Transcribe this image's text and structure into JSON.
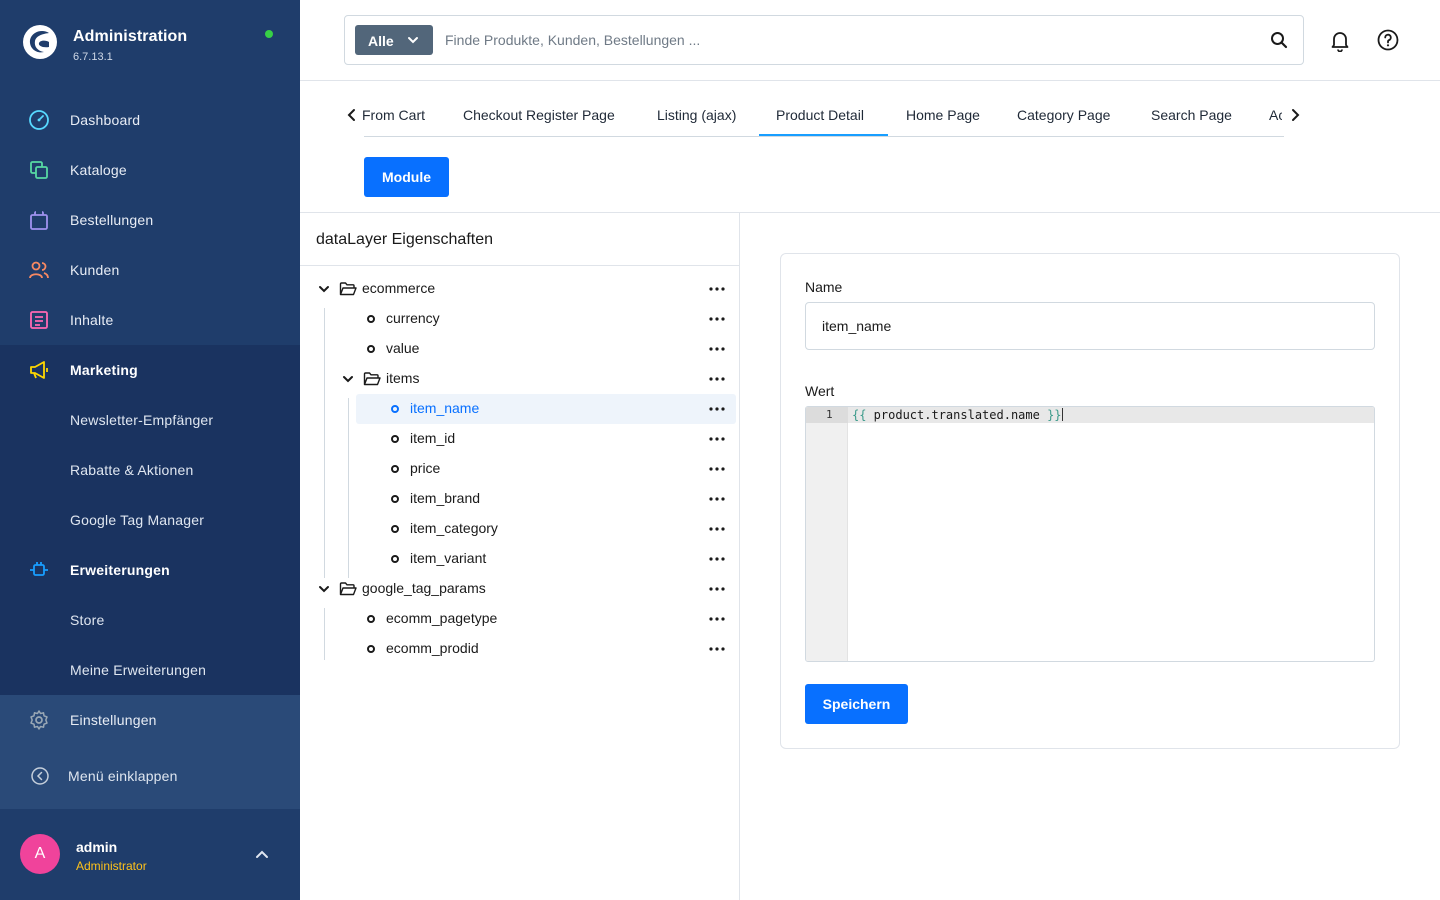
{
  "app": {
    "title": "Administration",
    "version": "6.7.13.1",
    "status_color": "#37d046",
    "logo": "shopware-logo-icon"
  },
  "sidebar": {
    "items": [
      {
        "label": "Dashboard",
        "icon": "dashboard-gauge-icon",
        "color": "#57d9ff"
      },
      {
        "label": "Kataloge",
        "icon": "catalog-icon",
        "color": "#57d9a3"
      },
      {
        "label": "Bestellungen",
        "icon": "shopping-bag-icon",
        "color": "#a092f0"
      },
      {
        "label": "Kunden",
        "icon": "customers-icon",
        "color": "#f88962"
      },
      {
        "label": "Inhalte",
        "icon": "content-icon",
        "color": "#ff68b4"
      },
      {
        "label": "Marketing",
        "icon": "megaphone-icon",
        "color": "#ffd700"
      },
      {
        "label": "Newsletter-Empfänger"
      },
      {
        "label": "Rabatte & Aktionen"
      },
      {
        "label": "Google Tag Manager"
      },
      {
        "label": "Erweiterungen",
        "icon": "plug-icon",
        "color": "#189eff"
      },
      {
        "label": "Store"
      },
      {
        "label": "Meine Erweiterungen"
      },
      {
        "label": "Einstellungen",
        "icon": "gear-icon",
        "color": "#9aa8b5"
      }
    ],
    "collapse_label": "Menü einklappen"
  },
  "user": {
    "initial": "A",
    "name": "admin",
    "role": "Administrator",
    "avatar_color": "#f0439b",
    "role_color": "#ffc21a"
  },
  "search": {
    "type_label": "Alle",
    "placeholder": "Finde Produkte, Kunden, Bestellungen ..."
  },
  "tabs": {
    "items": [
      "From Cart",
      "Checkout Register Page",
      "Listing (ajax)",
      "Product Detail",
      "Home Page",
      "Category Page",
      "Search Page",
      "Ac"
    ],
    "active": "Product Detail",
    "module_label": "Module"
  },
  "tree": {
    "title": "dataLayer Eigenschaften",
    "nodes": [
      {
        "label": "ecommerce",
        "type": "folder",
        "expanded": true
      },
      {
        "label": "currency",
        "type": "leaf"
      },
      {
        "label": "value",
        "type": "leaf"
      },
      {
        "label": "items",
        "type": "folder",
        "expanded": true
      },
      {
        "label": "item_name",
        "type": "leaf",
        "selected": true
      },
      {
        "label": "item_id",
        "type": "leaf"
      },
      {
        "label": "price",
        "type": "leaf"
      },
      {
        "label": "item_brand",
        "type": "leaf"
      },
      {
        "label": "item_category",
        "type": "leaf"
      },
      {
        "label": "item_variant",
        "type": "leaf"
      },
      {
        "label": "google_tag_params",
        "type": "folder",
        "expanded": true
      },
      {
        "label": "ecomm_pagetype",
        "type": "leaf"
      },
      {
        "label": "ecomm_prodid",
        "type": "leaf"
      }
    ]
  },
  "form": {
    "name_label": "Name",
    "name_value": "item_name",
    "value_label": "Wert",
    "code": {
      "line_number": "1",
      "open_brace": "{{",
      "content": " product.translated.name ",
      "close_brace": "}}"
    },
    "save_label": "Speichern",
    "accent_color": "#0870ff"
  }
}
